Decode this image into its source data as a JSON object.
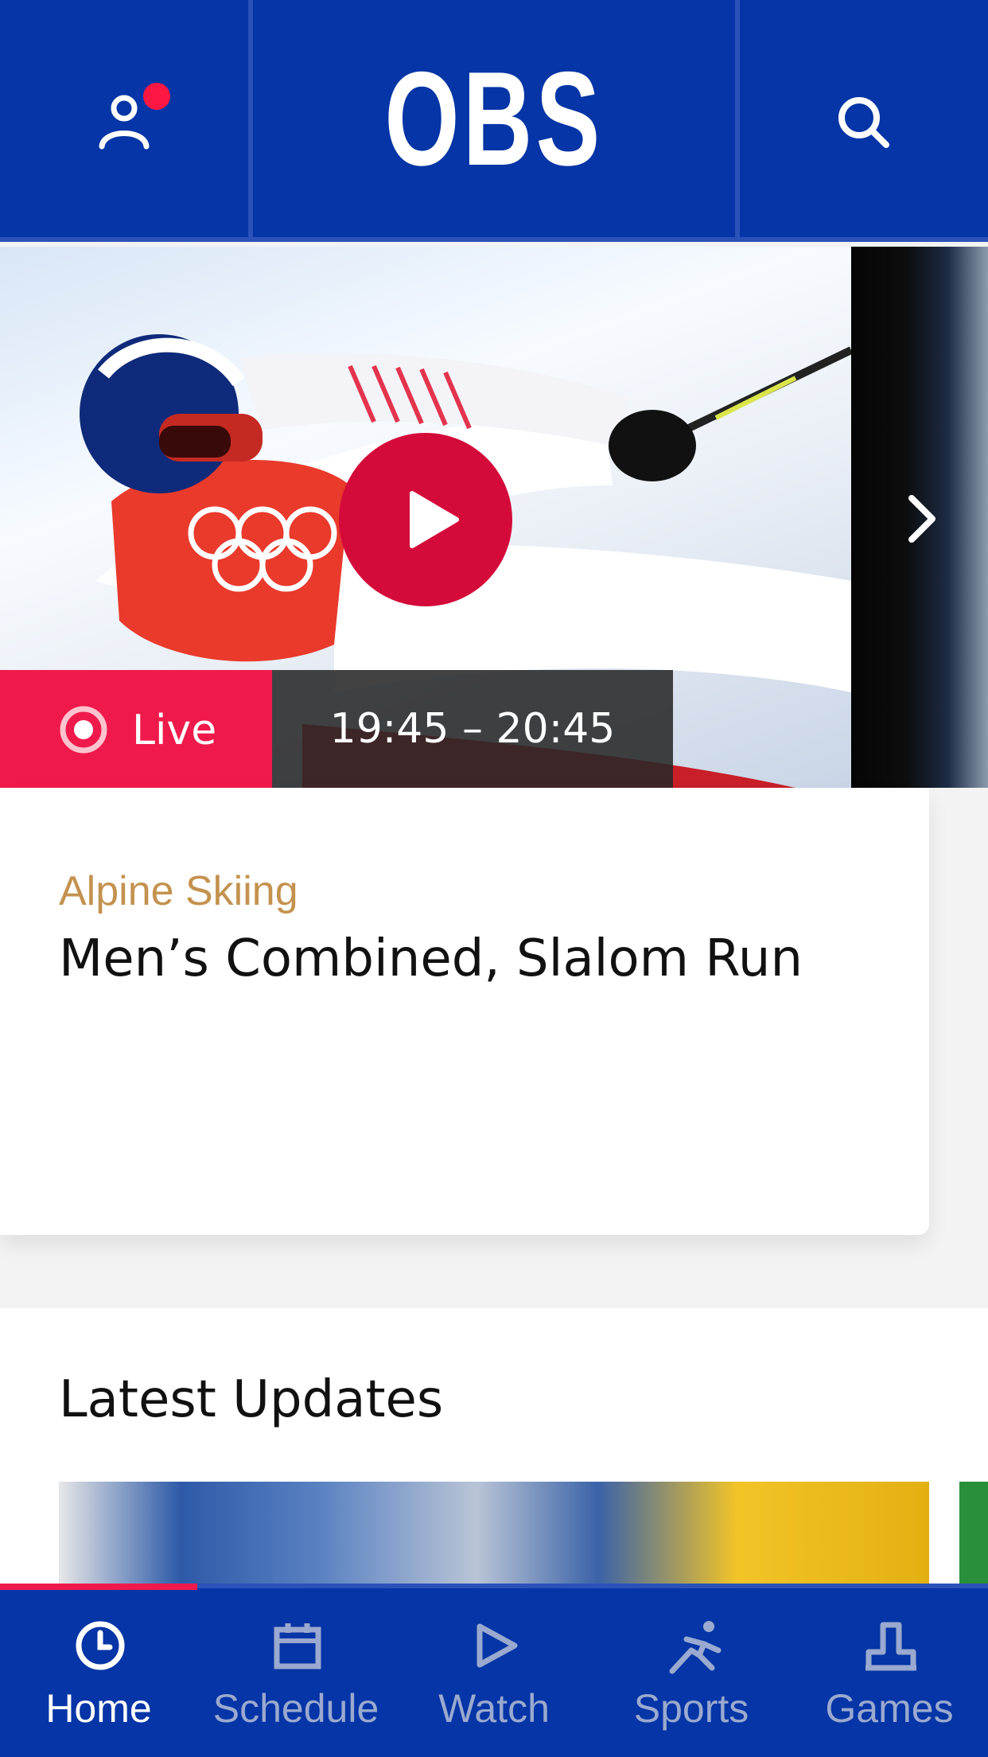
{
  "header": {
    "logo": "OBS",
    "profile_icon": "person-icon",
    "search_icon": "search-icon",
    "notification": true
  },
  "hero": {
    "status_label": "Live",
    "time_range": "19:45 – 20:45",
    "play_icon": "play-icon",
    "next_icon": "chevron-right-icon"
  },
  "card": {
    "sport": "Alpine Skiing",
    "title": "Men’s Combined, Slalom Run"
  },
  "updates": {
    "title": "Latest Updates"
  },
  "bottom_nav": {
    "items": [
      {
        "label": "Home",
        "icon": "clock-icon",
        "active": true
      },
      {
        "label": "Schedule",
        "icon": "calendar-icon",
        "active": false
      },
      {
        "label": "Watch",
        "icon": "play-outline-icon",
        "active": false
      },
      {
        "label": "Sports",
        "icon": "athlete-icon",
        "active": false
      },
      {
        "label": "Games",
        "icon": "podium-icon",
        "active": false
      }
    ]
  },
  "colors": {
    "brand_blue": "#0535a6",
    "live_red": "#ef1a4b",
    "play_red": "#d40b3a",
    "sport_gold": "#c4924f"
  }
}
